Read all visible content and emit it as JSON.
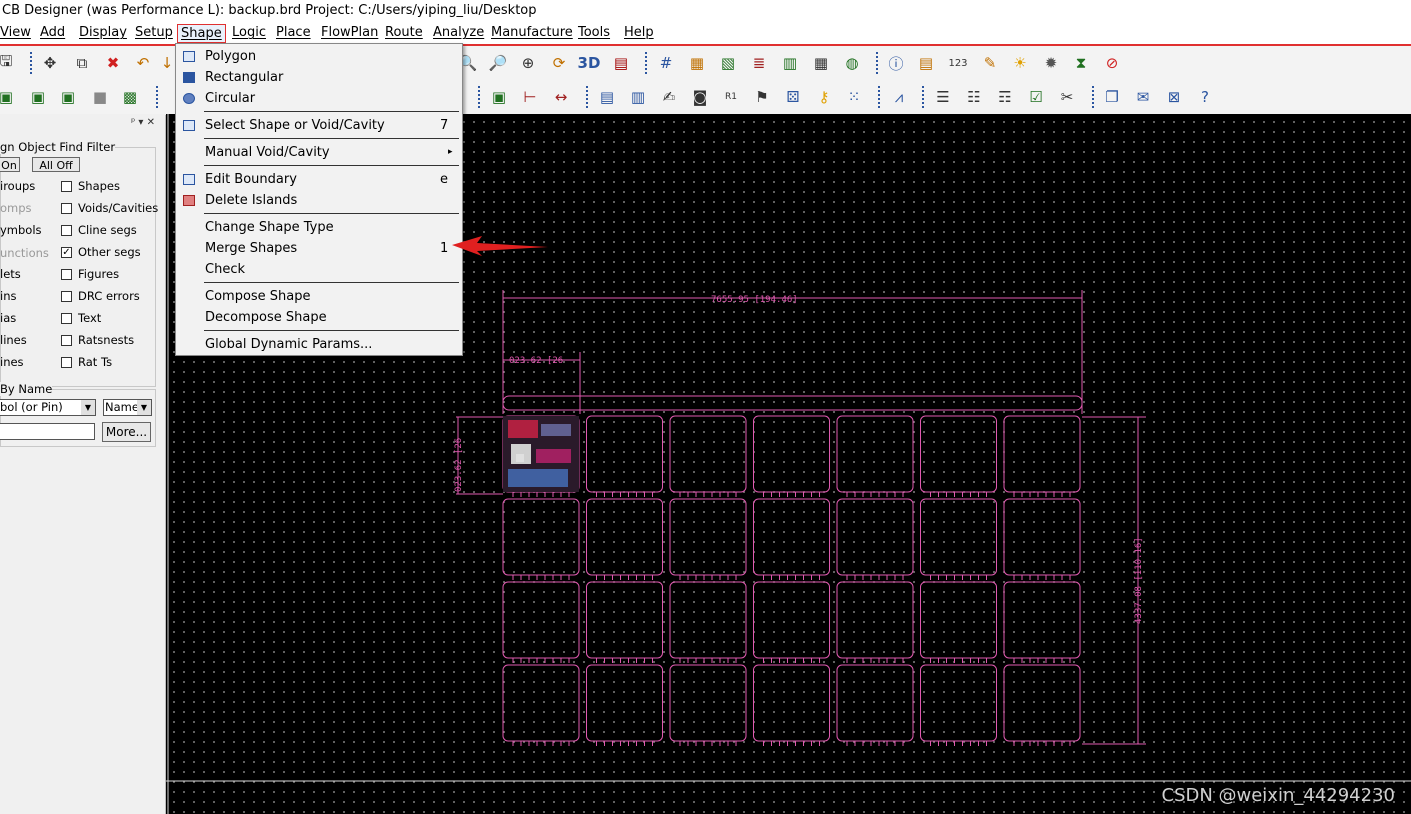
{
  "window": {
    "title": "CB Designer (was Performance L): backup.brd  Project: C:/Users/yiping_liu/Desktop"
  },
  "menubar": {
    "items": [
      "View",
      "Add",
      "Display",
      "Setup",
      "Shape",
      "Logic",
      "Place",
      "FlowPlan",
      "Route",
      "Analyze",
      "Manufacture",
      "Tools",
      "Help"
    ],
    "active": "Shape"
  },
  "shape_menu": {
    "items": [
      {
        "label": "Polygon",
        "shortcut": ""
      },
      {
        "label": "Rectangular",
        "shortcut": ""
      },
      {
        "label": "Circular",
        "shortcut": ""
      },
      {
        "label": "Select Shape or Void/Cavity",
        "shortcut": "7"
      },
      {
        "label": "Manual Void/Cavity",
        "shortcut": "▸"
      },
      {
        "label": "Edit Boundary",
        "shortcut": "e"
      },
      {
        "label": "Delete Islands",
        "shortcut": ""
      },
      {
        "label": "Change Shape Type",
        "shortcut": ""
      },
      {
        "label": "Merge Shapes",
        "shortcut": "1"
      },
      {
        "label": "Check",
        "shortcut": ""
      },
      {
        "label": "Compose Shape",
        "shortcut": ""
      },
      {
        "label": "Decompose Shape",
        "shortcut": ""
      },
      {
        "label": "Global Dynamic Params...",
        "shortcut": ""
      }
    ]
  },
  "find_filter": {
    "title": "gn Object Find Filter",
    "pin_icons": "ᵖ ▾ ✕",
    "on_button": "On",
    "off_button": "All Off",
    "left_items": [
      {
        "label": "iroups",
        "dim": false
      },
      {
        "label": "omps",
        "dim": true
      },
      {
        "label": "ymbols",
        "dim": false
      },
      {
        "label": "unctions",
        "dim": true
      },
      {
        "label": "lets",
        "dim": false
      },
      {
        "label": "ins",
        "dim": false
      },
      {
        "label": "ias",
        "dim": false
      },
      {
        "label": "lines",
        "dim": false
      },
      {
        "label": "ines",
        "dim": false
      }
    ],
    "right_items": [
      {
        "label": "Shapes",
        "checked": false
      },
      {
        "label": "Voids/Cavities",
        "checked": false
      },
      {
        "label": "Cline segs",
        "checked": false
      },
      {
        "label": "Other segs",
        "checked": true
      },
      {
        "label": "Figures",
        "checked": false
      },
      {
        "label": "DRC errors",
        "checked": false
      },
      {
        "label": "Text",
        "checked": false
      },
      {
        "label": "Ratsnests",
        "checked": false
      },
      {
        "label": "Rat Ts",
        "checked": false
      }
    ],
    "by_name_title": "By Name",
    "type_select": "bol (or Pin)",
    "name_select": "Name",
    "more_button": "More..."
  },
  "canvas": {
    "dim_top": "7655.95 [194.46]",
    "dim_small": "023.62 [26",
    "dim_left": "023.62 [26",
    "dim_right": "4337.08 [110.16]",
    "grid_rows": 4,
    "grid_cols": 7
  },
  "watermark": "CSDN @weixin_44294230",
  "colors": {
    "accent_red": "#e03030",
    "outline_pink": "#e05ab0",
    "canvas_bg": "#000000"
  }
}
